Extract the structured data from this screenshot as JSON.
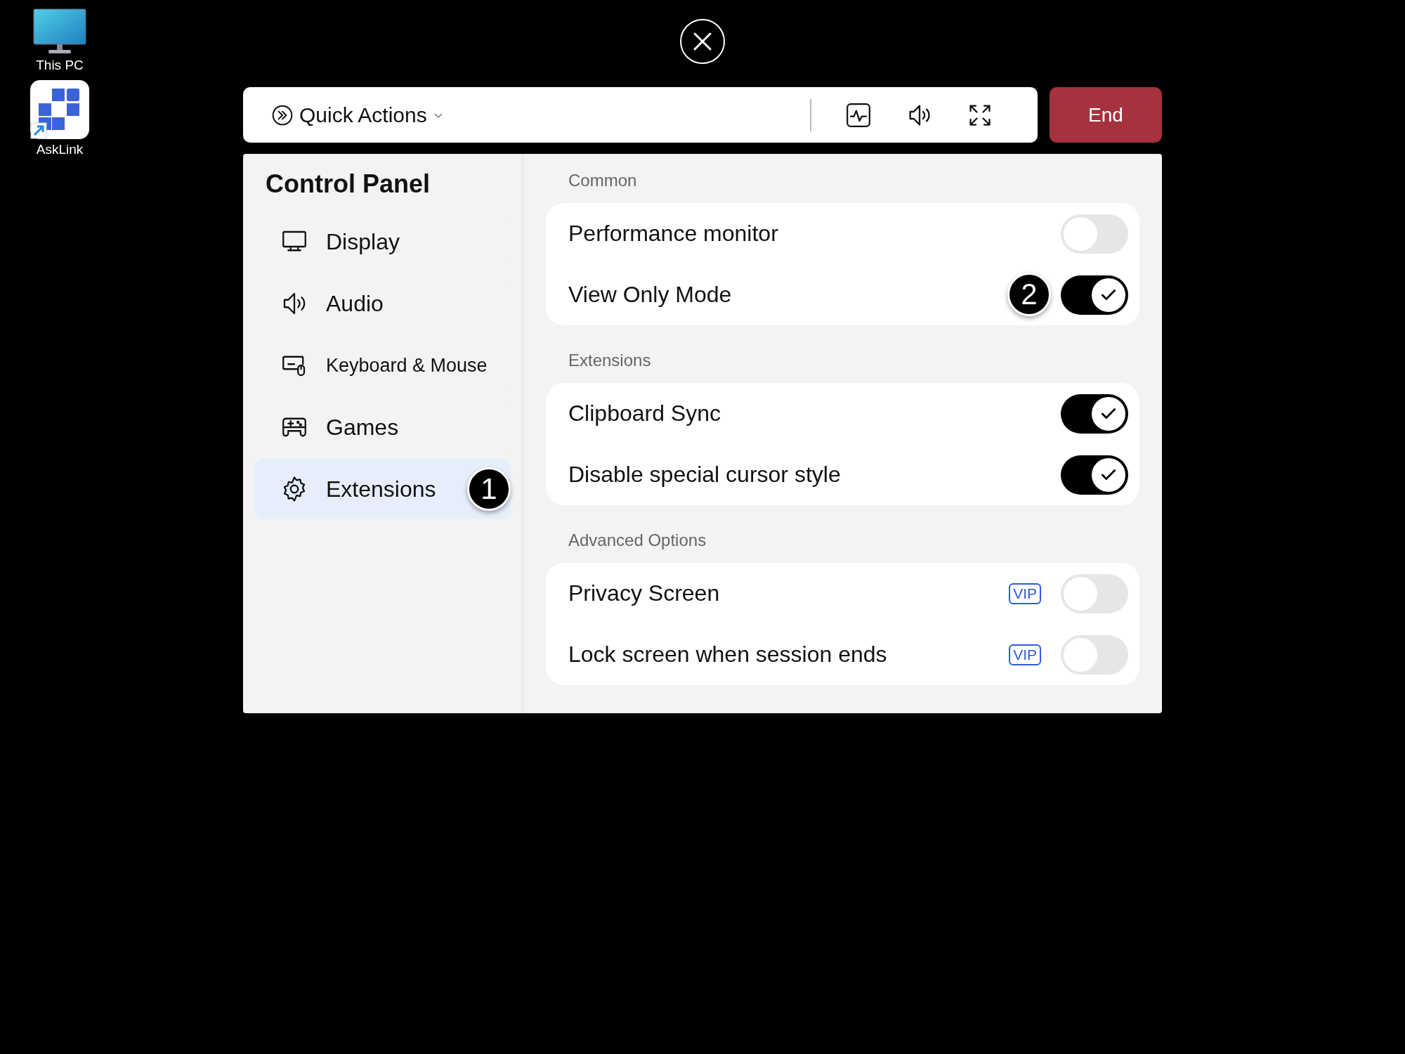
{
  "desktop": {
    "icons": [
      {
        "kind": "pc",
        "label": "This PC"
      },
      {
        "kind": "app",
        "label": "AskLink"
      }
    ]
  },
  "toolbar": {
    "quick_actions": "Quick Actions",
    "end_button": "End"
  },
  "sidebar": {
    "title": "Control Panel",
    "items": [
      {
        "kind": "display",
        "label": "Display",
        "selected": false
      },
      {
        "kind": "audio",
        "label": "Audio",
        "selected": false
      },
      {
        "kind": "keyboard",
        "label": "Keyboard & Mouse",
        "selected": false
      },
      {
        "kind": "games",
        "label": "Games",
        "selected": false
      },
      {
        "kind": "extensions",
        "label": "Extensions",
        "selected": true,
        "marker": "1"
      }
    ]
  },
  "sections": [
    {
      "title": "Common",
      "rows": [
        {
          "label": "Performance monitor",
          "on": false
        },
        {
          "label": "View Only Mode",
          "on": true,
          "marker": "2"
        }
      ]
    },
    {
      "title": "Extensions",
      "rows": [
        {
          "label": "Clipboard Sync",
          "on": true
        },
        {
          "label": "Disable special cursor style",
          "on": true
        }
      ]
    },
    {
      "title": "Advanced Options",
      "rows": [
        {
          "label": "Privacy Screen",
          "on": false,
          "badge": "VIP"
        },
        {
          "label": "Lock screen when session ends",
          "on": false,
          "badge": "VIP"
        }
      ]
    }
  ]
}
